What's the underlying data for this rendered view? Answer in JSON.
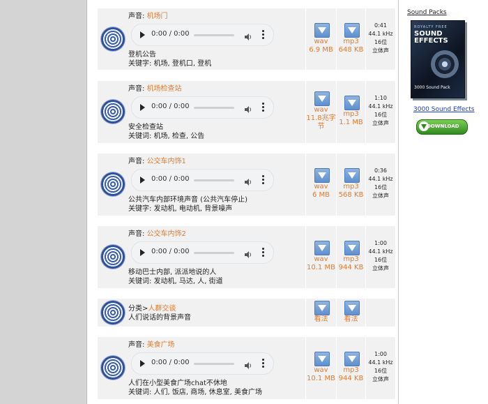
{
  "player": {
    "time": "0:00 / 0:00"
  },
  "rows": [
    {
      "label": "声音:",
      "name": "机场门",
      "line1": "登机公告",
      "line2": "关键字: 机场, 登机口, 登机",
      "wav": "wav",
      "wav_size": "6.9 MB",
      "mp3": "mp3",
      "mp3_size": "648 KB",
      "duration": "0:41",
      "rate": "44.1 kHz",
      "bits": "16位",
      "channels": "立体声"
    },
    {
      "label": "声音:",
      "name": "机场检查站",
      "line1": "安全检查站",
      "line2": "关键词: 机场, 检查, 公告",
      "wav": "wav",
      "wav_size_1": "11.8兆字",
      "wav_size_2": "节",
      "mp3": "mp3",
      "mp3_size": "1.1 MB",
      "duration": "1:10",
      "rate": "44.1 kHz",
      "bits": "16位",
      "channels": "立体声"
    },
    {
      "label": "声音:",
      "name": "公交车内饰1",
      "line1": "公共汽车内部环境声音 (公共汽车停止)",
      "line2": "关键字: 发动机, 电动机, 背景噪声",
      "wav": "wav",
      "wav_size": "6 MB",
      "mp3": "mp3",
      "mp3_size": "568 KB",
      "duration": "0:36",
      "rate": "44.1 kHz",
      "bits": "16位",
      "channels": "立体声"
    },
    {
      "label": "声音:",
      "name": "公交车内饰2",
      "line1": "移动巴士内部, 派派地说的人",
      "line2": "关键词: 发动机, 马达, 人, 街道",
      "wav": "wav",
      "wav_size": "10.1 MB",
      "mp3": "mp3",
      "mp3_size": "944 KB",
      "duration": "1:00",
      "rate": "44.1 kHz",
      "bits": "16位",
      "channels": "立体声"
    },
    {
      "label": "分类>",
      "name": "人群交谈",
      "line1": "人们说话的背景声音",
      "wav": "看法",
      "mp3": "看法"
    },
    {
      "label": "声音:",
      "name": "美食广场",
      "line1": "人们在小型美食广场chat不休地",
      "line2": "关键词: 人们, 饭店, 商场, 休息室, 美食广场",
      "wav": "wav",
      "wav_size": "10.1 MB",
      "mp3": "mp3",
      "mp3_size": "944 KB",
      "duration": "1:00",
      "rate": "44.1 kHz",
      "bits": "16位",
      "channels": "立体声"
    }
  ],
  "sidebar": {
    "title": "Sound Packs",
    "box_top": "ROYALTY FREE",
    "box_title": "SOUND EFFECTS",
    "box_bottom": "3000 Sound Pack",
    "link": "3000 Sound Effects",
    "download": "DOWNLOAD"
  }
}
